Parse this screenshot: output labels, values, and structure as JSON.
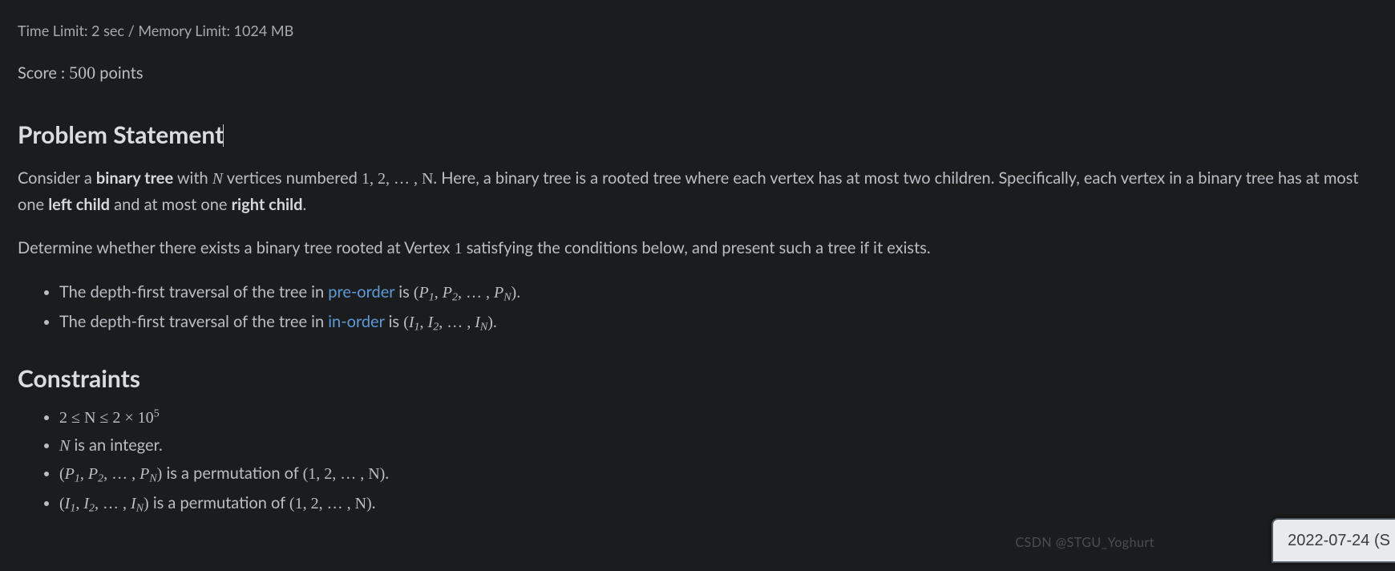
{
  "limits": "Time Limit: 2 sec / Memory Limit: 1024 MB",
  "score": {
    "prefix": "Score : ",
    "value": "500",
    "suffix": " points"
  },
  "headings": {
    "problem": "Problem Statement",
    "constraints": "Constraints"
  },
  "para1": {
    "t1": "Consider a ",
    "b1": "binary tree",
    "t2": " with ",
    "m_N": "N",
    "t3": " vertices numbered ",
    "m_list": "1, 2, … , N",
    "t4": ". Here, a binary tree is a rooted tree where each vertex has at most two children. Specifically, each vertex in a binary tree has at most one ",
    "b2": "left child",
    "t5": " and at most one ",
    "b3": "right child",
    "t6": "."
  },
  "para2": {
    "t1": "Determine whether there exists a binary tree rooted at Vertex ",
    "m_one": "1",
    "t2": " satisfying the conditions below, and present such a tree if it exists."
  },
  "conditions": {
    "c1": {
      "pre": "The depth-first traversal of the tree in ",
      "link": "pre-order",
      "mid": " is ",
      "seq_open": "(",
      "seq_terms": "P",
      "seq_close": ")."
    },
    "c2": {
      "pre": "The depth-first traversal of the tree in ",
      "link": "in-order",
      "mid": " is ",
      "seq_open": "(",
      "seq_terms": "I",
      "seq_close": ")."
    }
  },
  "constraints": {
    "k1": "2 ≤ N ≤ 2 × 10",
    "k1_exp": "5",
    "k2_head": "N",
    "k2_tail": " is an integer.",
    "perm_mid": " is a permutation of ",
    "perm_set": "(1, 2, … , N)",
    "perm_end": "."
  },
  "watermark": "CSDN @STGU_Yoghurt",
  "date_badge": "2022-07-24 (S"
}
